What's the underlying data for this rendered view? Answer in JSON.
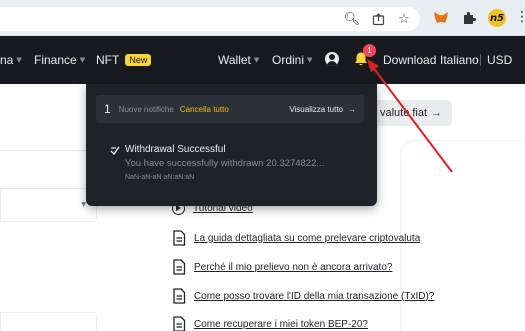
{
  "browser": {
    "icons": [
      "search-icon",
      "share-icon",
      "star-icon",
      "metamask-icon",
      "puzzle-icon",
      "n5-extension-icon",
      "kebab-menu-icon"
    ],
    "n5_label": "n5"
  },
  "nav": {
    "item_partial": "na",
    "finance": "Finance",
    "nft": "NFT",
    "nft_badge": "New",
    "wallet": "Wallet",
    "orders": "Ordini",
    "bell_count": "1",
    "download": "Download",
    "language": "Italiano",
    "currency": "USD"
  },
  "page": {
    "fiat_button": "valute fiat",
    "links": [
      {
        "label": "Tutorial video",
        "icon": "play-circle-icon"
      },
      {
        "label": "La guida dettagliata su come prelevare criptovaluta",
        "icon": "document-icon"
      },
      {
        "label": "Perché il mio prelievo non è ancora arrivato?",
        "icon": "document-icon"
      },
      {
        "label": "Come posso trovare l'ID della mia transazione (TxID)?",
        "icon": "document-icon"
      },
      {
        "label": "Come recuperare i miei token BEP-20?",
        "icon": "document-icon"
      }
    ]
  },
  "notifications": {
    "count": "1",
    "new_label": "Nuove notifiche",
    "clear_all": "Cancella tutto",
    "view_all": "Visualizza tutto",
    "items": [
      {
        "title": "Withdrawal Successful",
        "message": "You have successfully withdrawn 20.3274822...",
        "time": "NaN-aN-aN aN:aN:aN"
      }
    ]
  },
  "colors": {
    "nav_bg": "#181a20",
    "panel_bg": "#1e2329",
    "accent": "#fcd535",
    "link_yellow": "#f0b90b",
    "annotation_red": "#e02020"
  }
}
